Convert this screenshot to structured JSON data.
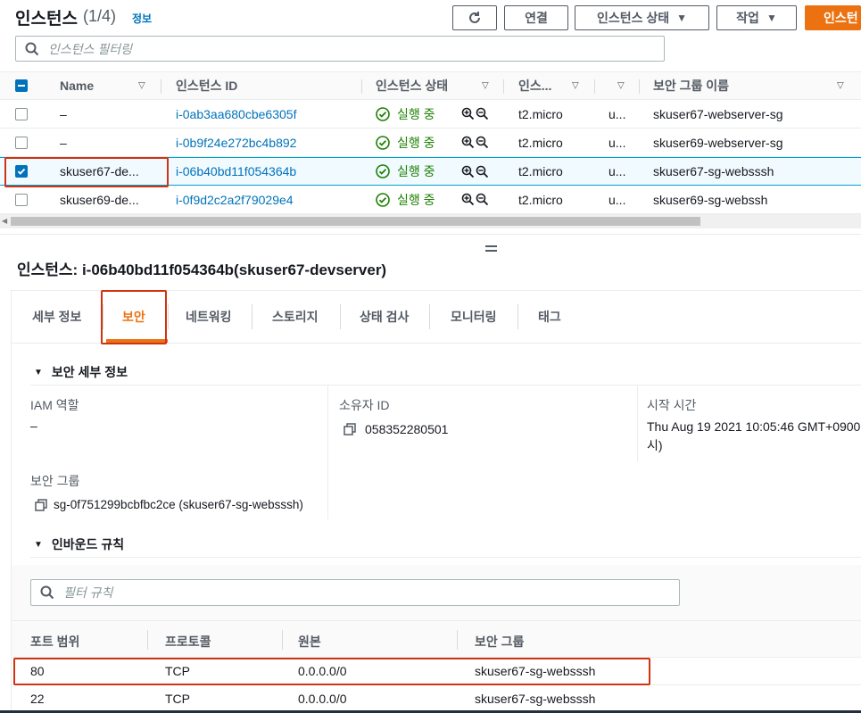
{
  "header": {
    "title": "인스턴스",
    "count": "(1/4)",
    "info": "정보",
    "buttons": {
      "connect": "연결",
      "instance_state": "인스턴스 상태",
      "actions": "작업",
      "launch": "인스턴"
    },
    "filter_placeholder": "인스턴스 필터링"
  },
  "table": {
    "columns": [
      "Name",
      "인스턴스 ID",
      "인스턴스 상태",
      "인스...",
      "",
      "보안 그룹 이름"
    ],
    "rows": [
      {
        "name": "–",
        "id": "i-0ab3aa680cbe6305f",
        "state": "실행 중",
        "type": "t2.micro",
        "col5": "u...",
        "sg": "skuser67-webserver-sg",
        "selected": false
      },
      {
        "name": "–",
        "id": "i-0b9f24e272bc4b892",
        "state": "실행 중",
        "type": "t2.micro",
        "col5": "u...",
        "sg": "skuser69-webserver-sg",
        "selected": false
      },
      {
        "name": "skuser67-de...",
        "id": "i-06b40bd11f054364b",
        "state": "실행 중",
        "type": "t2.micro",
        "col5": "u...",
        "sg": "skuser67-sg-websssh",
        "selected": true
      },
      {
        "name": "skuser69-de...",
        "id": "i-0f9d2c2a2f79029e4",
        "state": "실행 중",
        "type": "t2.micro",
        "col5": "u...",
        "sg": "skuser69-sg-webssh",
        "selected": false
      }
    ]
  },
  "details": {
    "title": "인스턴스: i-06b40bd11f054364b(skuser67-devserver)",
    "tabs": [
      "세부 정보",
      "보안",
      "네트워킹",
      "스토리지",
      "상태 검사",
      "모니터링",
      "태그"
    ],
    "active_tab": "보안",
    "security_section": "보안 세부 정보",
    "iam_label": "IAM 역할",
    "iam_value": "–",
    "owner_label": "소유자 ID",
    "owner_value": "058352280501",
    "launch_label": "시작 시간",
    "launch_value_1": "Thu Aug 19 2021 10:05:46 GMT+0900",
    "launch_value_2": "시)",
    "sg_label": "보안 그룹",
    "sg_value": "sg-0f751299bcbfbc2ce (skuser67-sg-websssh)",
    "inbound_section": "인바운드 규칙",
    "rules_filter_placeholder": "필터 규칙",
    "rules_columns": [
      "포트 범위",
      "프로토콜",
      "원본",
      "보안 그룹"
    ],
    "rules": [
      {
        "port": "80",
        "protocol": "TCP",
        "source": "0.0.0.0/0",
        "sg": "skuser67-sg-websssh"
      },
      {
        "port": "22",
        "protocol": "TCP",
        "source": "0.0.0.0/0",
        "sg": "skuser67-sg-websssh"
      }
    ]
  },
  "colors": {
    "accent": "#ec7211",
    "link": "#0073bb",
    "success": "#1d8102",
    "highlight": "#d13212"
  }
}
